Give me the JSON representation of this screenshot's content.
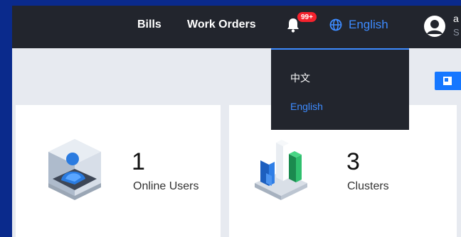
{
  "nav": {
    "bills": "Bills",
    "work_orders": "Work Orders",
    "notification_badge": "99+",
    "language": "English"
  },
  "user": {
    "name": "a",
    "role": "S"
  },
  "language_menu": {
    "options": [
      "中文",
      "English"
    ],
    "selected": "English"
  },
  "stats": [
    {
      "value": "1",
      "label": "Online Users"
    },
    {
      "value": "3",
      "label": "Clusters"
    }
  ],
  "colors": {
    "accent": "#3d8bff",
    "topbar": "#22252d",
    "badge": "#f5222d",
    "background": "#0a2a8c"
  }
}
